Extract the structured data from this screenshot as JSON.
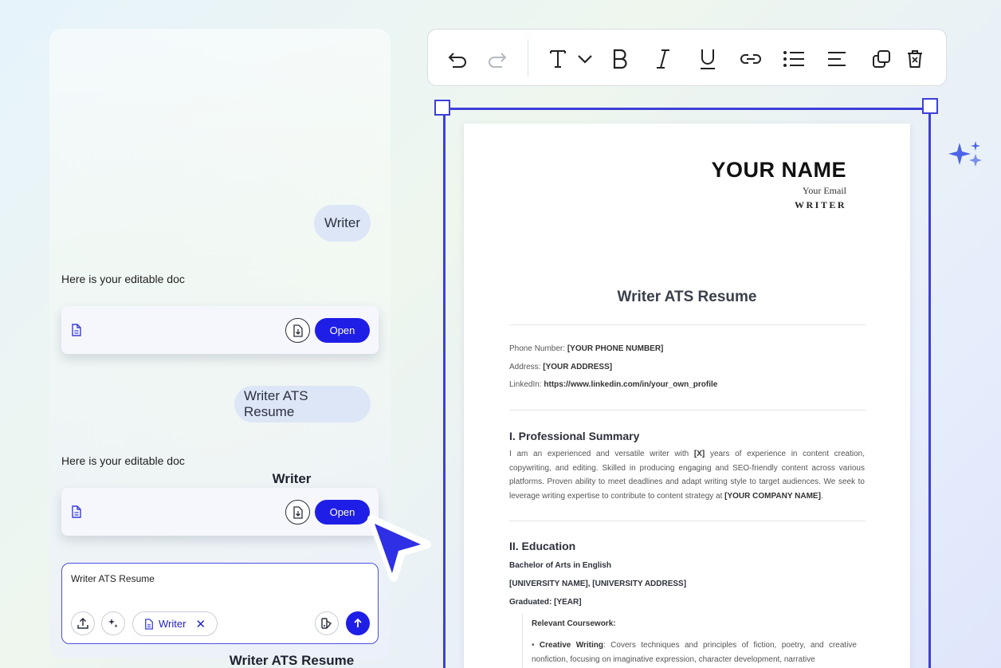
{
  "chat": {
    "user_messages": [
      "Writer",
      "Writer ATS Resume"
    ],
    "bot_messages": [
      "Here is your editable doc",
      "Here is your editable doc"
    ],
    "doc_cards": [
      {
        "title": "Writer",
        "open_label": "Open"
      },
      {
        "title": "Writer ATS Resume",
        "open_label": "Open"
      }
    ],
    "composer": {
      "input_value": "Writer ATS Resume",
      "chip_label": "Writer"
    }
  },
  "toolbar": {
    "icons": [
      "undo-icon",
      "redo-icon",
      "text-style-icon",
      "chevron-down-icon",
      "bold-icon",
      "italic-icon",
      "underline-icon",
      "link-icon",
      "bulleted-list-icon",
      "align-left-icon",
      "duplicate-icon",
      "delete-icon"
    ]
  },
  "document": {
    "name": "YOUR NAME",
    "email": "Your Email",
    "role": "WRITER",
    "title": "Writer ATS Resume",
    "contact": {
      "phone_label": "Phone Number:",
      "phone_value": "[YOUR PHONE NUMBER]",
      "address_label": "Address:",
      "address_value": "[YOUR ADDRESS]",
      "linkedin_label": "LinkedIn:",
      "linkedin_value": "https://www.linkedin.com/in/your_own_profile"
    },
    "summary": {
      "heading": "I. Professional Summary",
      "p1": "I am an experienced and versatile writer with",
      "x": "[X]",
      "p2": "years of experience in content creation, copywriting, and editing. Skilled in producing engaging and SEO-friendly content across various platforms. Proven ability to meet deadlines and adapt writing style to target audiences. We seek to leverage writing expertise to contribute to content strategy at",
      "company": "[YOUR COMPANY NAME]",
      "end": "."
    },
    "education": {
      "heading": "II. Education",
      "degree": "Bachelor of Arts in English",
      "university": "[UNIVERSITY NAME], [UNIVERSITY ADDRESS]",
      "graduated": "Graduated: [YEAR]",
      "coursework_heading": "Relevant Coursework:",
      "course1_name": "Creative Writing",
      "course1_desc": ": Covers techniques and principles of fiction, poetry, and creative nonfiction, focusing on imaginative expression, character development, narrative"
    }
  },
  "colors": {
    "accent": "#1f1ee6",
    "selection": "#3e3fd8",
    "bubble": "#dde6f6"
  }
}
